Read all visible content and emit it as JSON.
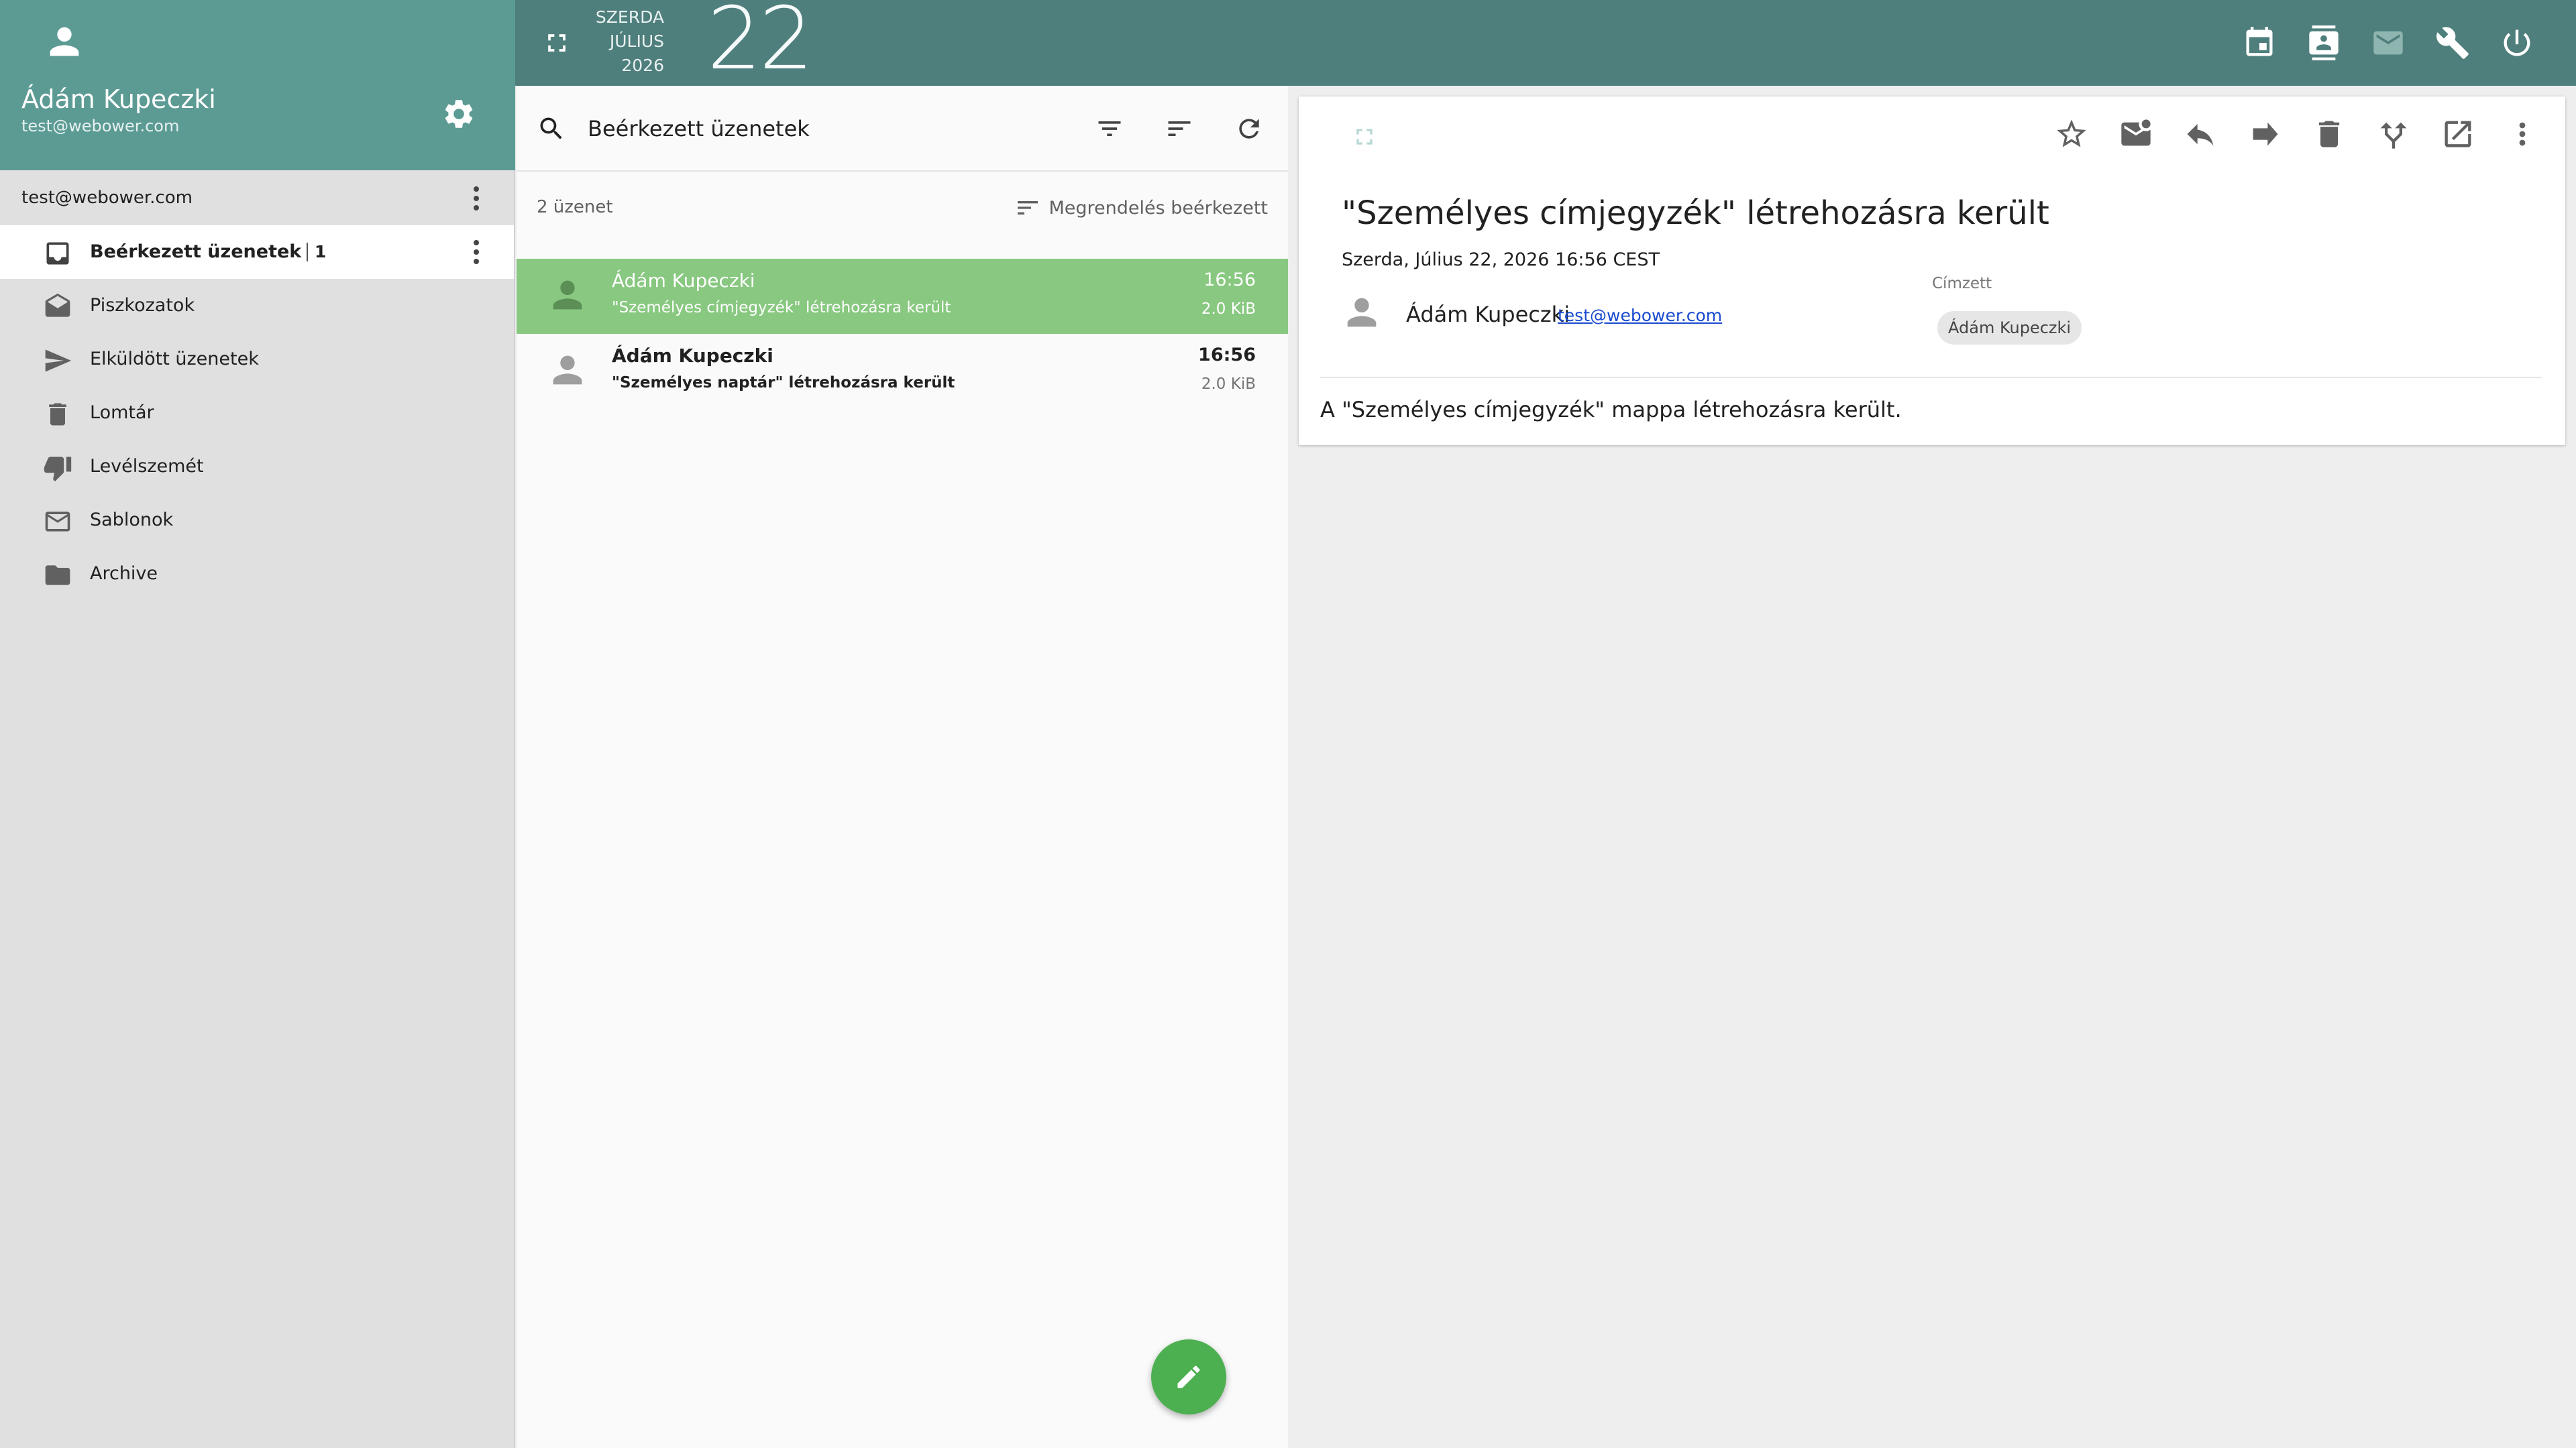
{
  "sidebar": {
    "user_name": "Ádám Kupeczki",
    "user_email": "test@webower.com",
    "account_email": "test@webower.com",
    "folders": [
      {
        "label": "Beérkezett üzenetek",
        "count": "1",
        "icon": "inbox-icon",
        "active": true
      },
      {
        "label": "Piszkozatok",
        "icon": "drafts-icon"
      },
      {
        "label": "Elküldött üzenetek",
        "icon": "send-icon"
      },
      {
        "label": "Lomtár",
        "icon": "trash-icon"
      },
      {
        "label": "Levélszemét",
        "icon": "thumb-down-icon"
      },
      {
        "label": "Sablonok",
        "icon": "mail-outline-icon"
      },
      {
        "label": "Archive",
        "icon": "folder-icon"
      }
    ]
  },
  "topbar": {
    "weekday": "SZERDA",
    "month": "JÚLIUS",
    "year": "2026",
    "day": "22",
    "icons": [
      "calendar-icon",
      "contacts-icon",
      "mail-icon",
      "wrench-icon",
      "power-icon"
    ]
  },
  "list": {
    "search_value": "Beérkezett üzenetek",
    "message_count": "2 üzenet",
    "sort_label": "Megrendelés beérkezett",
    "messages": [
      {
        "sender": "Ádám Kupeczki",
        "subject": "\"Személyes címjegyzék\" létrehozásra került",
        "time": "16:56",
        "size": "2.0 KiB",
        "selected": true,
        "unread": false
      },
      {
        "sender": "Ádám Kupeczki",
        "subject": "\"Személyes naptár\" létrehozásra került",
        "time": "16:56",
        "size": "2.0 KiB",
        "selected": false,
        "unread": true
      }
    ]
  },
  "reader": {
    "subject": "\"Személyes címjegyzék\" létrehozásra került",
    "date": "Szerda, Július 22, 2026 16:56 CEST",
    "from_name": "Ádám Kupeczki",
    "from_email": "test@webower.com",
    "to_label": "Címzett",
    "to_chip": "Ádám Kupeczki",
    "body": "A \"Személyes címjegyzék\" mappa létrehozásra került."
  },
  "colors": {
    "sidebar_header": "#5c9b94",
    "topbar": "#4f7f7c",
    "selected_row": "#88c880",
    "fab": "#4caf50"
  }
}
